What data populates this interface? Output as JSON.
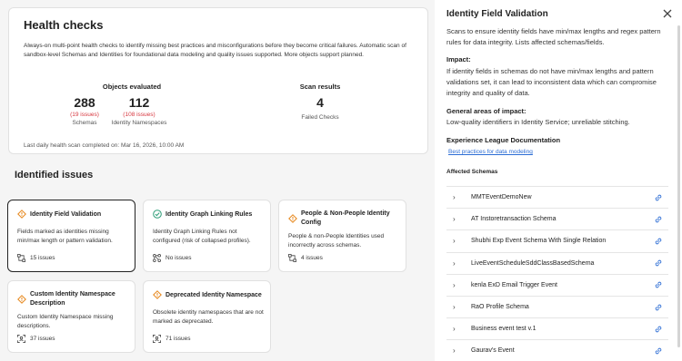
{
  "health": {
    "title": "Health checks",
    "description": "Always-on multi-point health checks to identify missing best practices and misconfigurations before they become critical failures. Automatic scan of sandbox-level Schemas and Identities for foundational data modeling and quality issues supported. More objects support planned.",
    "objects_title": "Objects evaluated",
    "scan_title": "Scan results",
    "schemas_count": "288",
    "schemas_issues": "(19 issues)",
    "schemas_label": "Schemas",
    "ns_count": "112",
    "ns_issues": "(108 issues)",
    "ns_label": "Identity Namespaces",
    "failed_count": "4",
    "failed_label": "Failed Checks",
    "footer": "Last daily health scan completed on: Mar 16, 2026, 10:00 AM"
  },
  "issues": {
    "title": "Identified issues",
    "cards": [
      {
        "title": "Identity Field Validation",
        "desc": "Fields marked as identities missing min/max length or pattern validation.",
        "count": "15 issues",
        "status_icon": "warning-icon",
        "count_icon": "schema-icon"
      },
      {
        "title": "Identity Graph Linking Rules",
        "desc": "Identity Graph Linking Rules not configured (risk of collapsed profiles).",
        "count": "No issues",
        "status_icon": "check-circle-icon",
        "count_icon": "graph-icon"
      },
      {
        "title": "People & Non-People Identity Config",
        "desc": "People & non-People Identities used incorrectly across schemas.",
        "count": "4 issues",
        "status_icon": "warning-icon",
        "count_icon": "schema-icon"
      },
      {
        "title": "Custom Identity Namespace Description",
        "desc": "Custom Identity Namespace missing descriptions.",
        "count": "37 issues",
        "status_icon": "warning-icon",
        "count_icon": "namespace-icon"
      },
      {
        "title": "Deprecated Identity Namespace",
        "desc": "Obsolete identity namespaces that are not marked as deprecated.",
        "count": "71 issues",
        "status_icon": "warning-icon",
        "count_icon": "namespace-icon"
      }
    ]
  },
  "panel": {
    "title": "Identity Field Validation",
    "intro": "Scans to ensure identity fields have min/max lengths and regex pattern rules for data integrity. Lists affected schemas/fields.",
    "impact_h": "Impact:",
    "impact": "If identity fields in schemas do not have min/max lengths and pattern validations set, it can lead to inconsistent data which can compromise integrity and quality of data.",
    "areas_h": "General areas of impact:",
    "areas": "Low-quality identifiers in Identity Service; unreliable stitching.",
    "docs_h": "Experience League Documentation",
    "docs_link": "Best practices for data modeling",
    "affected_h": "Affected Schemas",
    "schemas": [
      "MMTEventDemoNew",
      "AT Instoretransaction Schema",
      "Shubhi Exp Event Schema With Single Relation",
      "LiveEventScheduleSddClassBasedSchema",
      "kenla ExD Email Trigger Event",
      "RaO Profile Schema",
      "Business event test v.1",
      "Gaurav's Event"
    ]
  },
  "colors": {
    "warning": "#e68619",
    "success": "#2d9d78",
    "link": "#2b6cd4",
    "error": "#d7373f"
  }
}
